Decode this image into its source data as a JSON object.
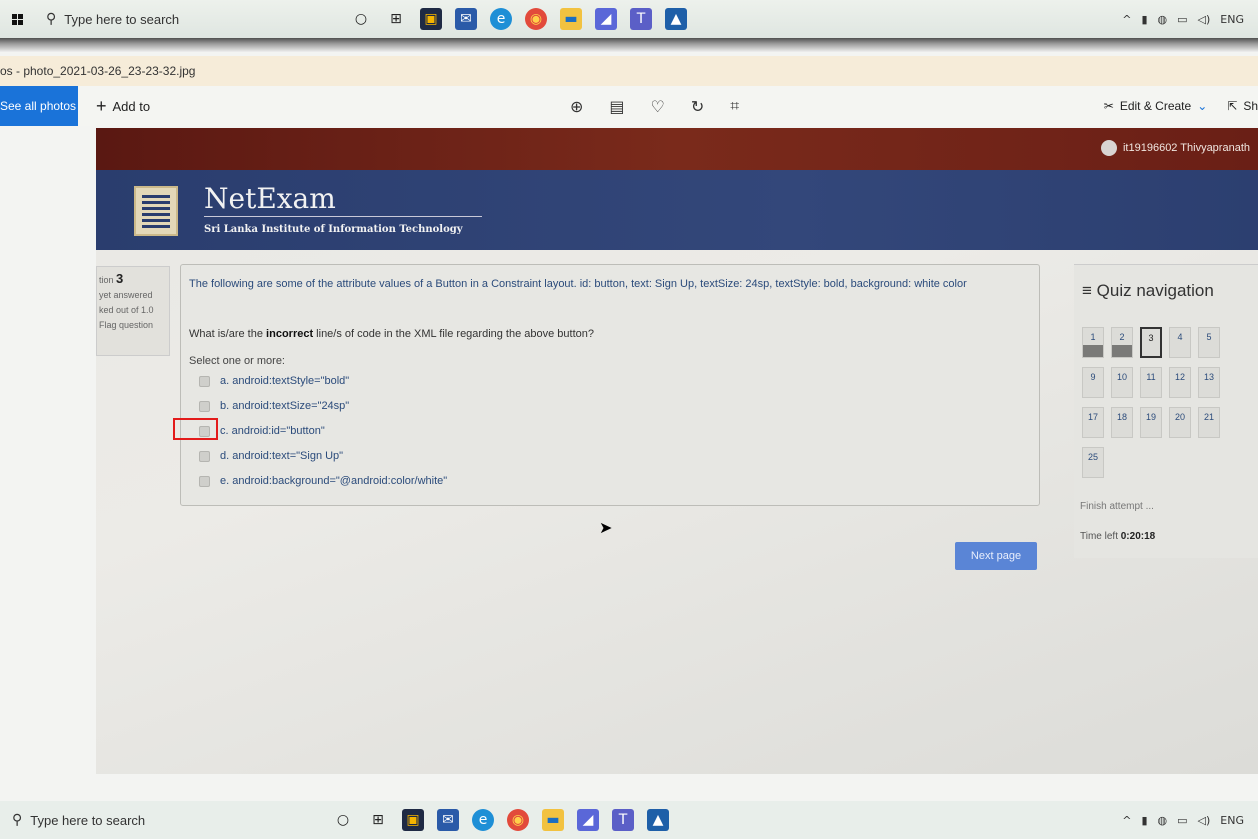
{
  "taskbar": {
    "search_placeholder": "Type here to search",
    "tray_lang": "ENG"
  },
  "photos_app": {
    "window_title": "os - photo_2021-03-26_23-23-32.jpg",
    "see_all": "See all photos",
    "add_to": "Add to",
    "edit_create": "Edit & Create",
    "share": "Sh"
  },
  "netexam": {
    "user": "it19196602 Thivyapranath",
    "brand": "NetExam",
    "subtitle": "Sri Lanka Institute of Information Technology",
    "question_info": {
      "label": "tion",
      "number": "3",
      "status": "yet answered",
      "marked": "ked out of 1.0",
      "flag": "Flag question"
    },
    "question_text": "The following are some of the attribute values of a Button in a Constraint layout. id: button, text: Sign Up, textSize: 24sp, textStyle: bold, background: white color",
    "question_ask_pre": "What is/are the ",
    "question_ask_bold": "incorrect",
    "question_ask_post": " line/s of code in the XML file regarding the above button?",
    "select_label": "Select one or more:",
    "options": [
      "a. android:textStyle=\"bold\"",
      "b. android:textSize=\"24sp\"",
      "c. android:id=\"button\"",
      "d. android:text=\"Sign Up\"",
      "e. android:background=\"@android:color/white\""
    ],
    "next_page": "Next page",
    "quiz_nav_title": "Quiz navigation",
    "nav_numbers": [
      "1",
      "2",
      "3",
      "4",
      "5",
      "9",
      "10",
      "11",
      "12",
      "13",
      "17",
      "18",
      "19",
      "20",
      "21",
      "25"
    ],
    "finish_attempt": "Finish attempt ...",
    "time_left_label": "Time left ",
    "time_left_value": "0:20:18"
  }
}
